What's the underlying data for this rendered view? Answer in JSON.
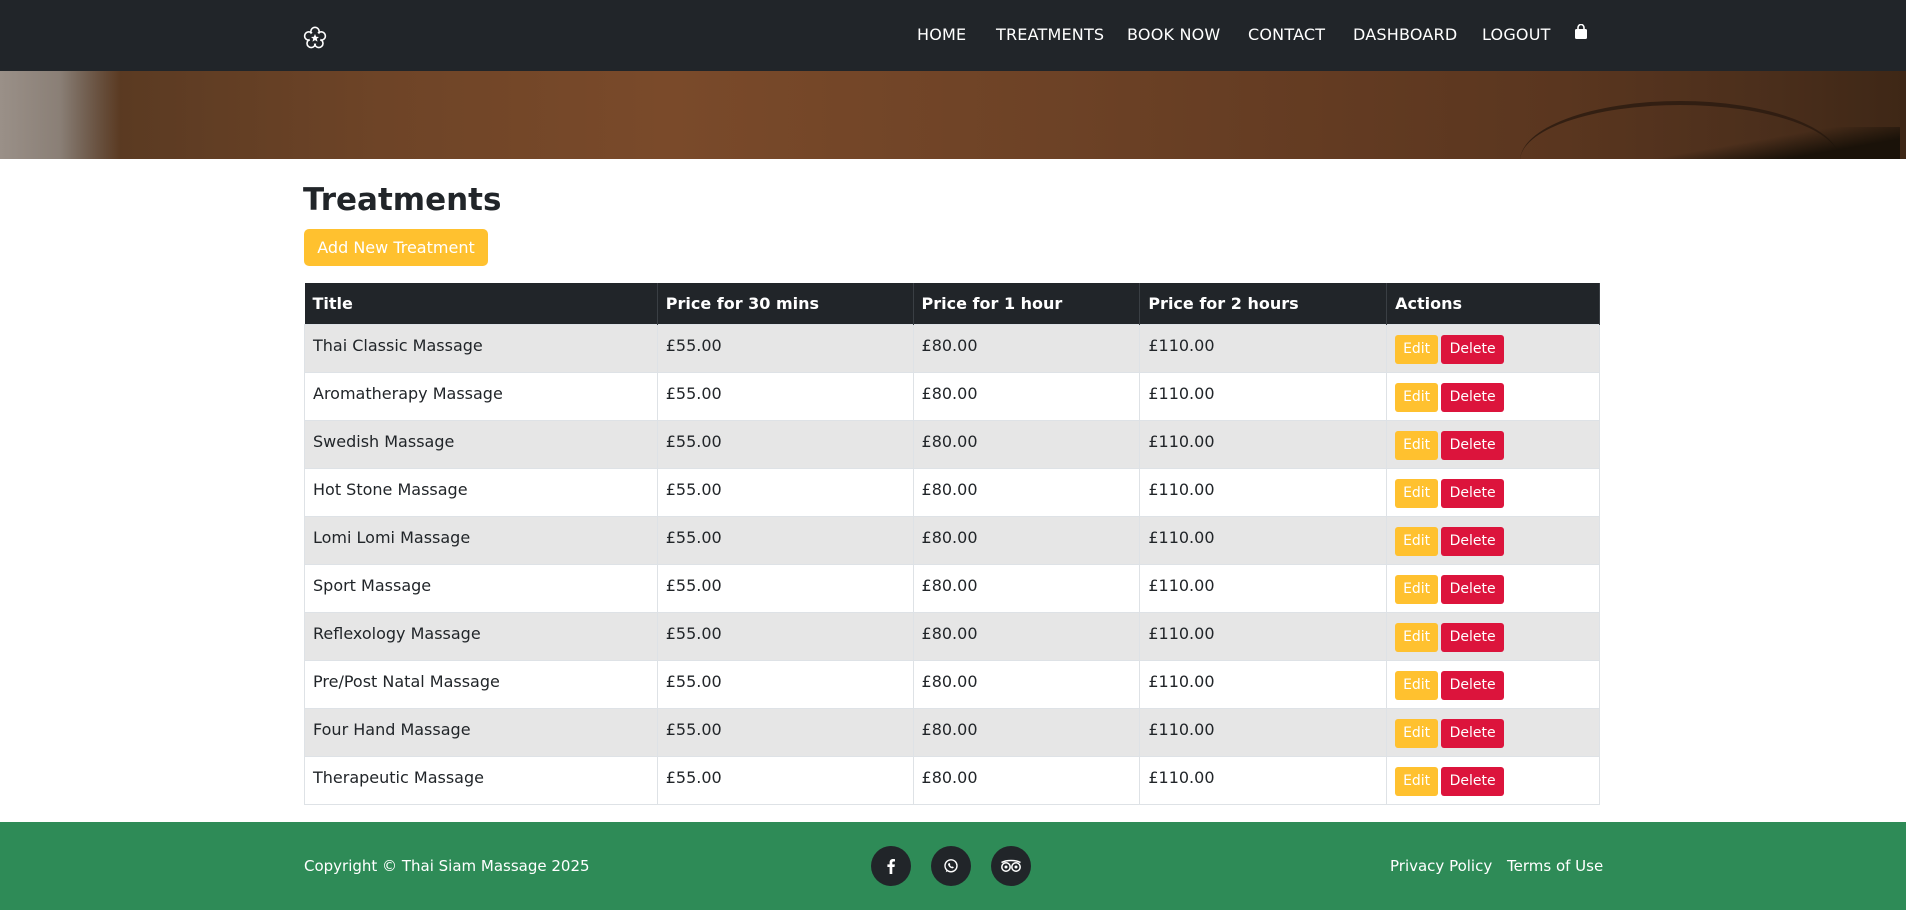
{
  "nav": {
    "logo_icon": "flower-star-icon",
    "links": [
      "HOME",
      "TREATMENTS",
      "BOOK NOW",
      "CONTACT",
      "DASHBOARD",
      "LOGOUT"
    ],
    "cart_icon": "shopping-bag-icon"
  },
  "main": {
    "title": "Treatments",
    "add_button": "Add New Treatment"
  },
  "table": {
    "headers": [
      "Title",
      "Price for 30 mins",
      "Price for 1 hour",
      "Price for 2 hours",
      "Actions"
    ],
    "rows": [
      {
        "title": "Thai Classic Massage",
        "p30": "£55.00",
        "p60": "£80.00",
        "p120": "£110.00"
      },
      {
        "title": "Aromatherapy Massage",
        "p30": "£55.00",
        "p60": "£80.00",
        "p120": "£110.00"
      },
      {
        "title": "Swedish Massage",
        "p30": "£55.00",
        "p60": "£80.00",
        "p120": "£110.00"
      },
      {
        "title": "Hot Stone Massage",
        "p30": "£55.00",
        "p60": "£80.00",
        "p120": "£110.00"
      },
      {
        "title": "Lomi Lomi Massage",
        "p30": "£55.00",
        "p60": "£80.00",
        "p120": "£110.00"
      },
      {
        "title": "Sport Massage",
        "p30": "£55.00",
        "p60": "£80.00",
        "p120": "£110.00"
      },
      {
        "title": "Reflexology Massage",
        "p30": "£55.00",
        "p60": "£80.00",
        "p120": "£110.00"
      },
      {
        "title": "Pre/Post Natal Massage",
        "p30": "£55.00",
        "p60": "£80.00",
        "p120": "£110.00"
      },
      {
        "title": "Four Hand Massage",
        "p30": "£55.00",
        "p60": "£80.00",
        "p120": "£110.00"
      },
      {
        "title": "Therapeutic Massage",
        "p30": "£55.00",
        "p60": "£80.00",
        "p120": "£110.00"
      }
    ],
    "edit_label": "Edit",
    "delete_label": "Delete"
  },
  "footer": {
    "copyright": "Copyright © Thai Siam Massage 2025",
    "social_icons": [
      "facebook-icon",
      "whatsapp-icon",
      "tripadvisor-icon"
    ],
    "links": [
      "Privacy Policy",
      "Terms of Use"
    ]
  },
  "colors": {
    "navbar": "#212529",
    "accent_yellow": "#ffc12f",
    "delete_red": "#dc143c",
    "footer_green": "#2e8b57",
    "row_stripe": "#e6e6e6"
  }
}
